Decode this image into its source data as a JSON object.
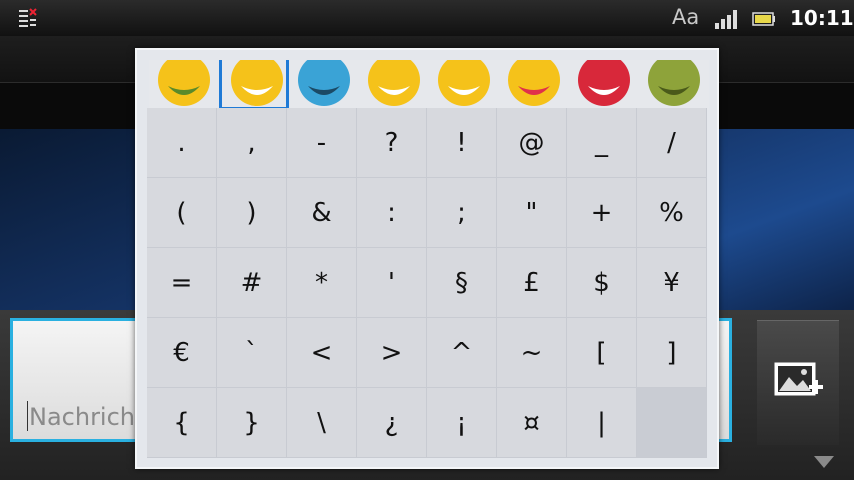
{
  "status_bar": {
    "time": "10:11",
    "aa_label": "Aa",
    "notification_icon": "list-notification-icon",
    "signal_icon": "signal-bars-icon",
    "battery_icon": "battery-icon"
  },
  "compose": {
    "placeholder": "Nachrich",
    "attach_icon": "attach-image-icon"
  },
  "symbol_popup": {
    "smileys": [
      {
        "name": "smile-icon",
        "face": "#f5c21a",
        "accent": "#5a8a2a"
      },
      {
        "name": "grin-icon",
        "face": "#f5c21a",
        "accent": "#ffffff"
      },
      {
        "name": "shock-blue-icon",
        "face": "#3aa3d6",
        "accent": "#1b4a66"
      },
      {
        "name": "surprised-icon",
        "face": "#f5c21a",
        "accent": "#ffffff"
      },
      {
        "name": "laugh-icon",
        "face": "#f5c21a",
        "accent": "#ffffff"
      },
      {
        "name": "tongue-icon",
        "face": "#f5c21a",
        "accent": "#e0304a"
      },
      {
        "name": "angry-red-icon",
        "face": "#d8283a",
        "accent": "#ffffff"
      },
      {
        "name": "sick-green-icon",
        "face": "#8ea33a",
        "accent": "#4a5a1a"
      }
    ],
    "selected_smiley": 1,
    "keys": [
      ".",
      ",",
      "-",
      "?",
      "!",
      "@",
      "_",
      "/",
      "(",
      ")",
      "&",
      ":",
      ";",
      "\"",
      "+",
      "%",
      "=",
      "#",
      "*",
      "'",
      "§",
      "£",
      "$",
      "¥",
      "€",
      "`",
      "<",
      ">",
      "^",
      "~",
      "[",
      "]",
      "{",
      "}",
      "\\",
      "¿",
      "¡",
      "¤",
      "|",
      ""
    ],
    "border_color": "#1f7ad6"
  }
}
